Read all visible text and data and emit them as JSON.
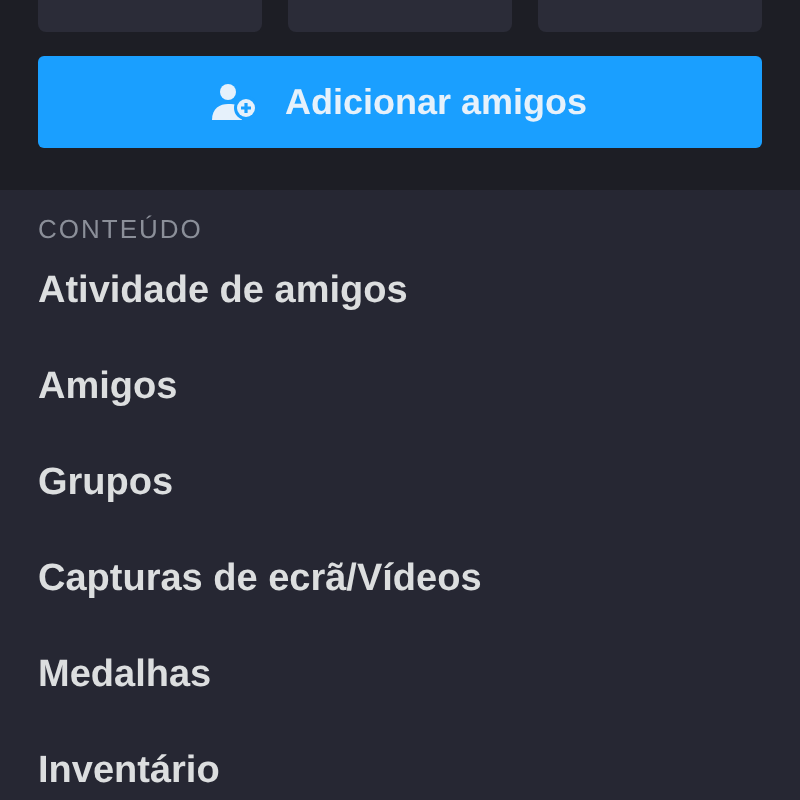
{
  "add_button": {
    "label": "Adicionar amigos"
  },
  "section": {
    "heading": "CONTEÚDO",
    "items": [
      {
        "label": "Atividade de amigos"
      },
      {
        "label": "Amigos"
      },
      {
        "label": "Grupos"
      },
      {
        "label": "Capturas de ecrã/Vídeos"
      },
      {
        "label": "Medalhas"
      },
      {
        "label": "Inventário"
      }
    ]
  }
}
